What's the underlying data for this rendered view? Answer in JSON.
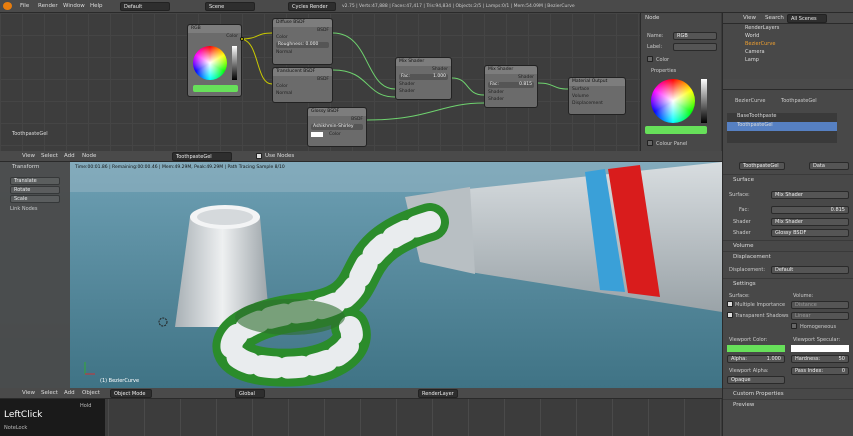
{
  "topbar": {
    "menus": [
      "File",
      "Render",
      "Window",
      "Help"
    ],
    "layout": "Default",
    "scene": "Scene",
    "engine": "Cycles Render",
    "stats": "v2.75 | Verts:47,888 | Faces:47,417 | Tris:94,834 | Objects:2/5 | Lamps:0/1 | Mem:54.09M | BezierCurve"
  },
  "node_editor": {
    "material_label": "ToothpasteGel",
    "nodes": {
      "rgb": {
        "title": "RGB",
        "out": "Color"
      },
      "diffuse": {
        "title": "Diffuse BSDF",
        "out": "BSDF",
        "color": "Color",
        "roughness": "Roughness:",
        "roughness_val": "0.000",
        "normal": "Normal"
      },
      "translucent": {
        "title": "Translucent BSDF",
        "out": "BSDF",
        "color": "Color",
        "normal": "Normal"
      },
      "glossy": {
        "title": "Glossy BSDF",
        "out": "BSDF",
        "dist": "Ashikhmin-Shirley",
        "color": "Color"
      },
      "mix1": {
        "title": "Mix Shader",
        "out": "Shader",
        "fac": "Fac:",
        "fac_val": "1.000",
        "s1": "Shader",
        "s2": "Shader"
      },
      "mix2": {
        "title": "Mix Shader",
        "out": "Shader",
        "fac": "Fac:",
        "fac_val": "0.815",
        "s1": "Shader",
        "s2": "Shader"
      },
      "output": {
        "title": "Material Output",
        "surface": "Surface",
        "volume": "Volume",
        "displacement": "Displacement"
      }
    },
    "toolbar": {
      "items": [
        "View",
        "Select",
        "Add",
        "Node"
      ],
      "material": "ToothpasteGel",
      "use_nodes": "Use Nodes"
    }
  },
  "node_props": {
    "title": "Node",
    "name_label": "Name:",
    "name_val": "RGB",
    "label_label": "Label:",
    "label_val": "",
    "color_label": "Color",
    "properties_label": "Properties",
    "colour_panel": "Colour Panel"
  },
  "outliner": {
    "view": "View",
    "search": "Search",
    "all_scenes": "All Scenes",
    "items": [
      "RenderLayers",
      "World",
      "BezierCurve",
      "Camera",
      "Lamp"
    ]
  },
  "viewport": {
    "status": "Time:00:01.86 | Remaining:00:00.46 | Mem:49.29M, Peak:49.29M | Path Tracing Sample 8/10",
    "object_label": "(1) BezierCurve",
    "toolshelf": {
      "title": "Transform",
      "buttons": [
        "Translate",
        "Rotate",
        "Scale"
      ],
      "link_title": "Link Nodes"
    },
    "header": {
      "items": [
        "View",
        "Select",
        "Add",
        "Object"
      ],
      "mode": "Object Mode",
      "orient": "Global",
      "layer": "RenderLayer"
    }
  },
  "properties": {
    "breadcrumb": [
      "BezierCurve",
      "ToothpasteGel"
    ],
    "materials": [
      "BaseToothpaste",
      "ToothpasteGel"
    ],
    "material_name": "ToothpasteGel",
    "data": "Data",
    "surface_title": "Surface",
    "surface_label": "Surface:",
    "surface_val": "Mix Shader",
    "fac_label": "Fac:",
    "fac_val": "0.815",
    "shader1_label": "Shader",
    "shader1_val": "Mix Shader",
    "shader2_label": "Shader",
    "shader2_val": "Glossy BSDF",
    "volume_title": "Volume",
    "displacement_title": "Displacement",
    "displacement_label": "Displacement:",
    "displacement_val": "Default",
    "settings_title": "Settings",
    "surface2": "Surface:",
    "volume2": "Volume:",
    "multiple_importance": "Multiple Importance",
    "transparent_shadows": "Transparent Shadows",
    "distance": "Distance",
    "linear": "Linear",
    "homogeneous": "Homogeneous",
    "viewport_color": "Viewport Color:",
    "viewport_specular": "Viewport Specular:",
    "alpha": "Alpha:",
    "alpha_val": "1.000",
    "hardness": "Hardness:",
    "hardness_val": "50",
    "viewport_alpha": "Viewport Alpha:",
    "opaque": "Opaque",
    "pass_index": "Pass Index:",
    "pass_val": "0",
    "custom_props": "Custom Properties",
    "preview": "Preview"
  },
  "screencast": {
    "main": "LeftClick",
    "sub": "Hold",
    "sub2": "NoteLock",
    "sub3": "-"
  },
  "colors": {
    "green": "#67e05a",
    "blue_select": "#5680c2",
    "bg_render": "#4a7d90"
  }
}
